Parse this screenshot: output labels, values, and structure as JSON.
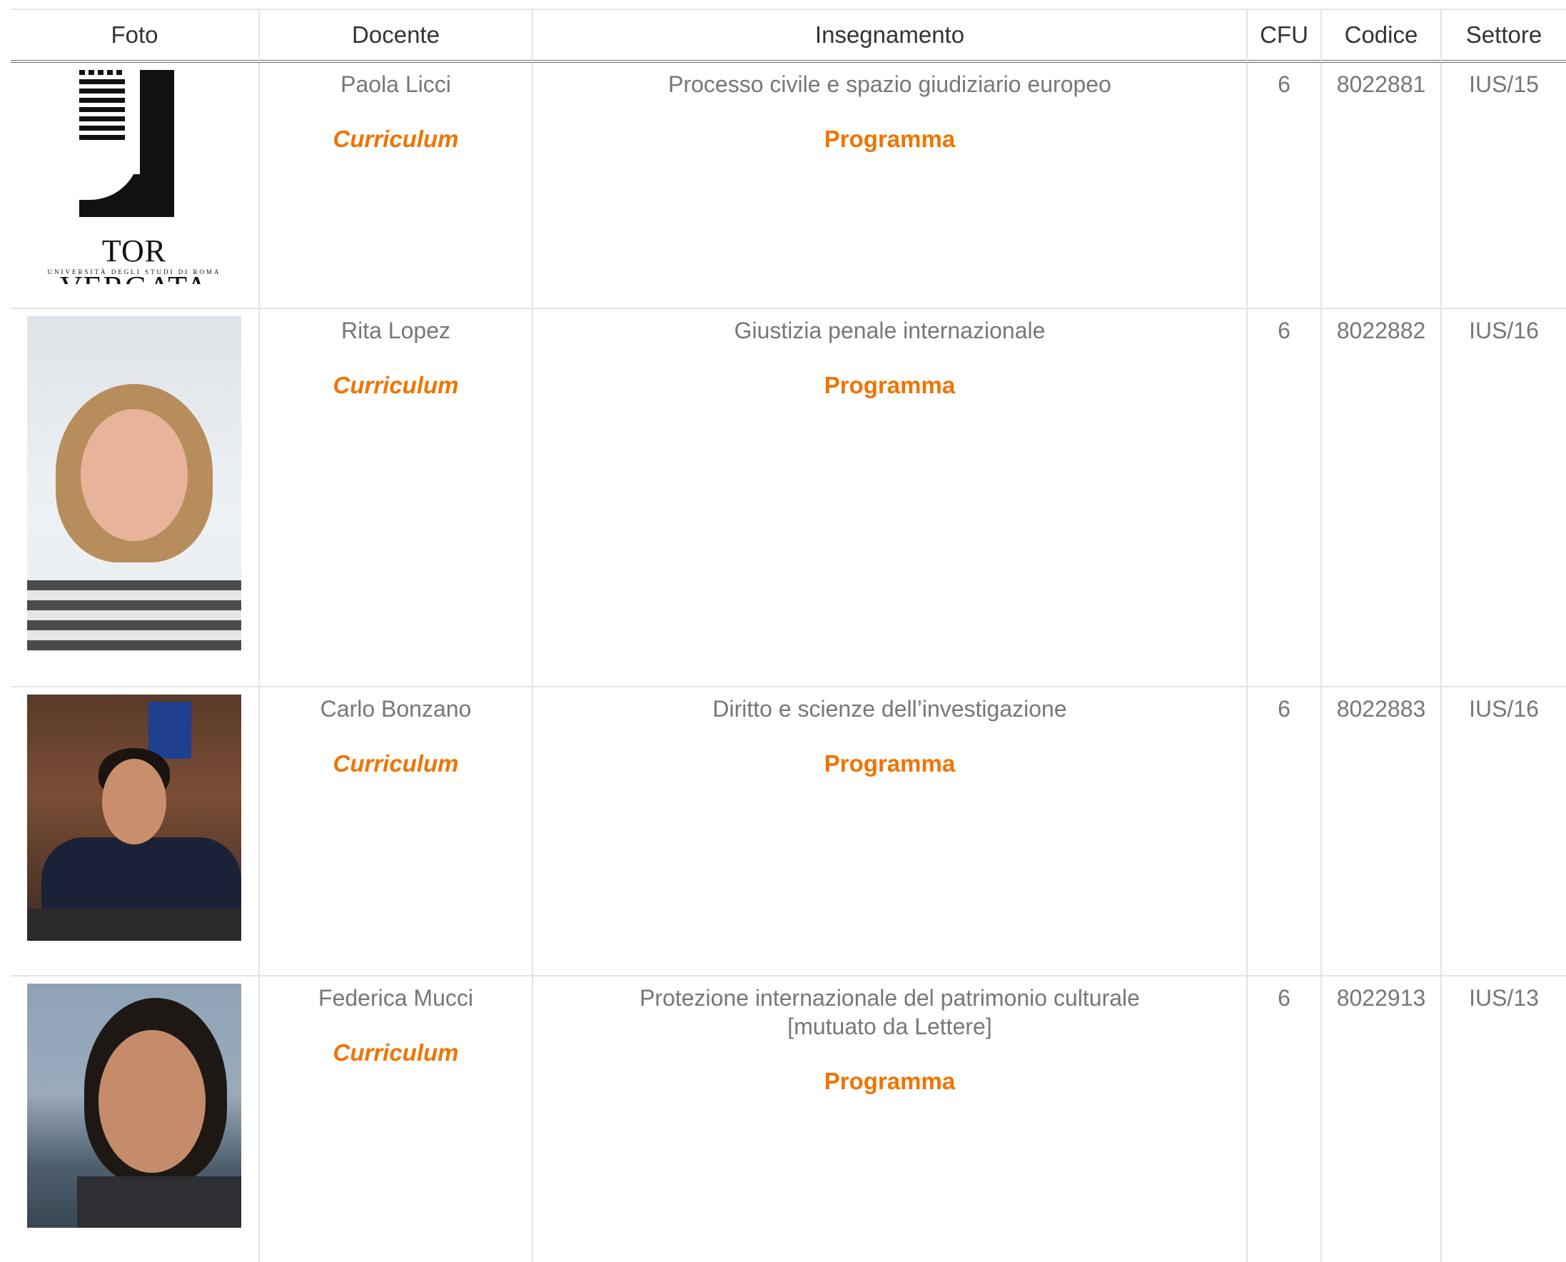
{
  "table": {
    "headers": {
      "foto": "Foto",
      "docente": "Docente",
      "insegnamento": "Insegnamento",
      "cfu": "CFU",
      "codice": "Codice",
      "settore": "Settore"
    },
    "rows": [
      {
        "docente": "Paola Licci",
        "curriculum": "Curriculum",
        "insegnamento": "Processo civile e spazio giudiziario europeo",
        "programma": "Programma",
        "cfu": "6",
        "codice": "8022881",
        "settore": "IUS/15",
        "logo_text": "TOR VERGATA",
        "logo_subtext": "UNIVERSITÀ DEGLI STUDI DI ROMA"
      },
      {
        "docente": "Rita Lopez",
        "curriculum": "Curriculum",
        "insegnamento": "Giustizia penale internazionale",
        "programma": "Programma",
        "cfu": "6",
        "codice": "8022882",
        "settore": "IUS/16"
      },
      {
        "docente": "Carlo Bonzano",
        "curriculum": "Curriculum",
        "insegnamento": "Diritto e scienze dell’investigazione",
        "programma": "Programma",
        "cfu": "6",
        "codice": "8022883",
        "settore": "IUS/16"
      },
      {
        "docente": "Federica Mucci",
        "curriculum": "Curriculum",
        "insegnamento": "Protezione internazionale del patrimonio culturale",
        "insegnamento_note": "[mutuato da Lettere]",
        "programma": "Programma",
        "cfu": "6",
        "codice": "8022913",
        "settore": "IUS/13"
      }
    ]
  },
  "colors": {
    "link": "#f07400",
    "text": "#777777",
    "header_text": "#333333",
    "border": "#e3e3e3"
  }
}
